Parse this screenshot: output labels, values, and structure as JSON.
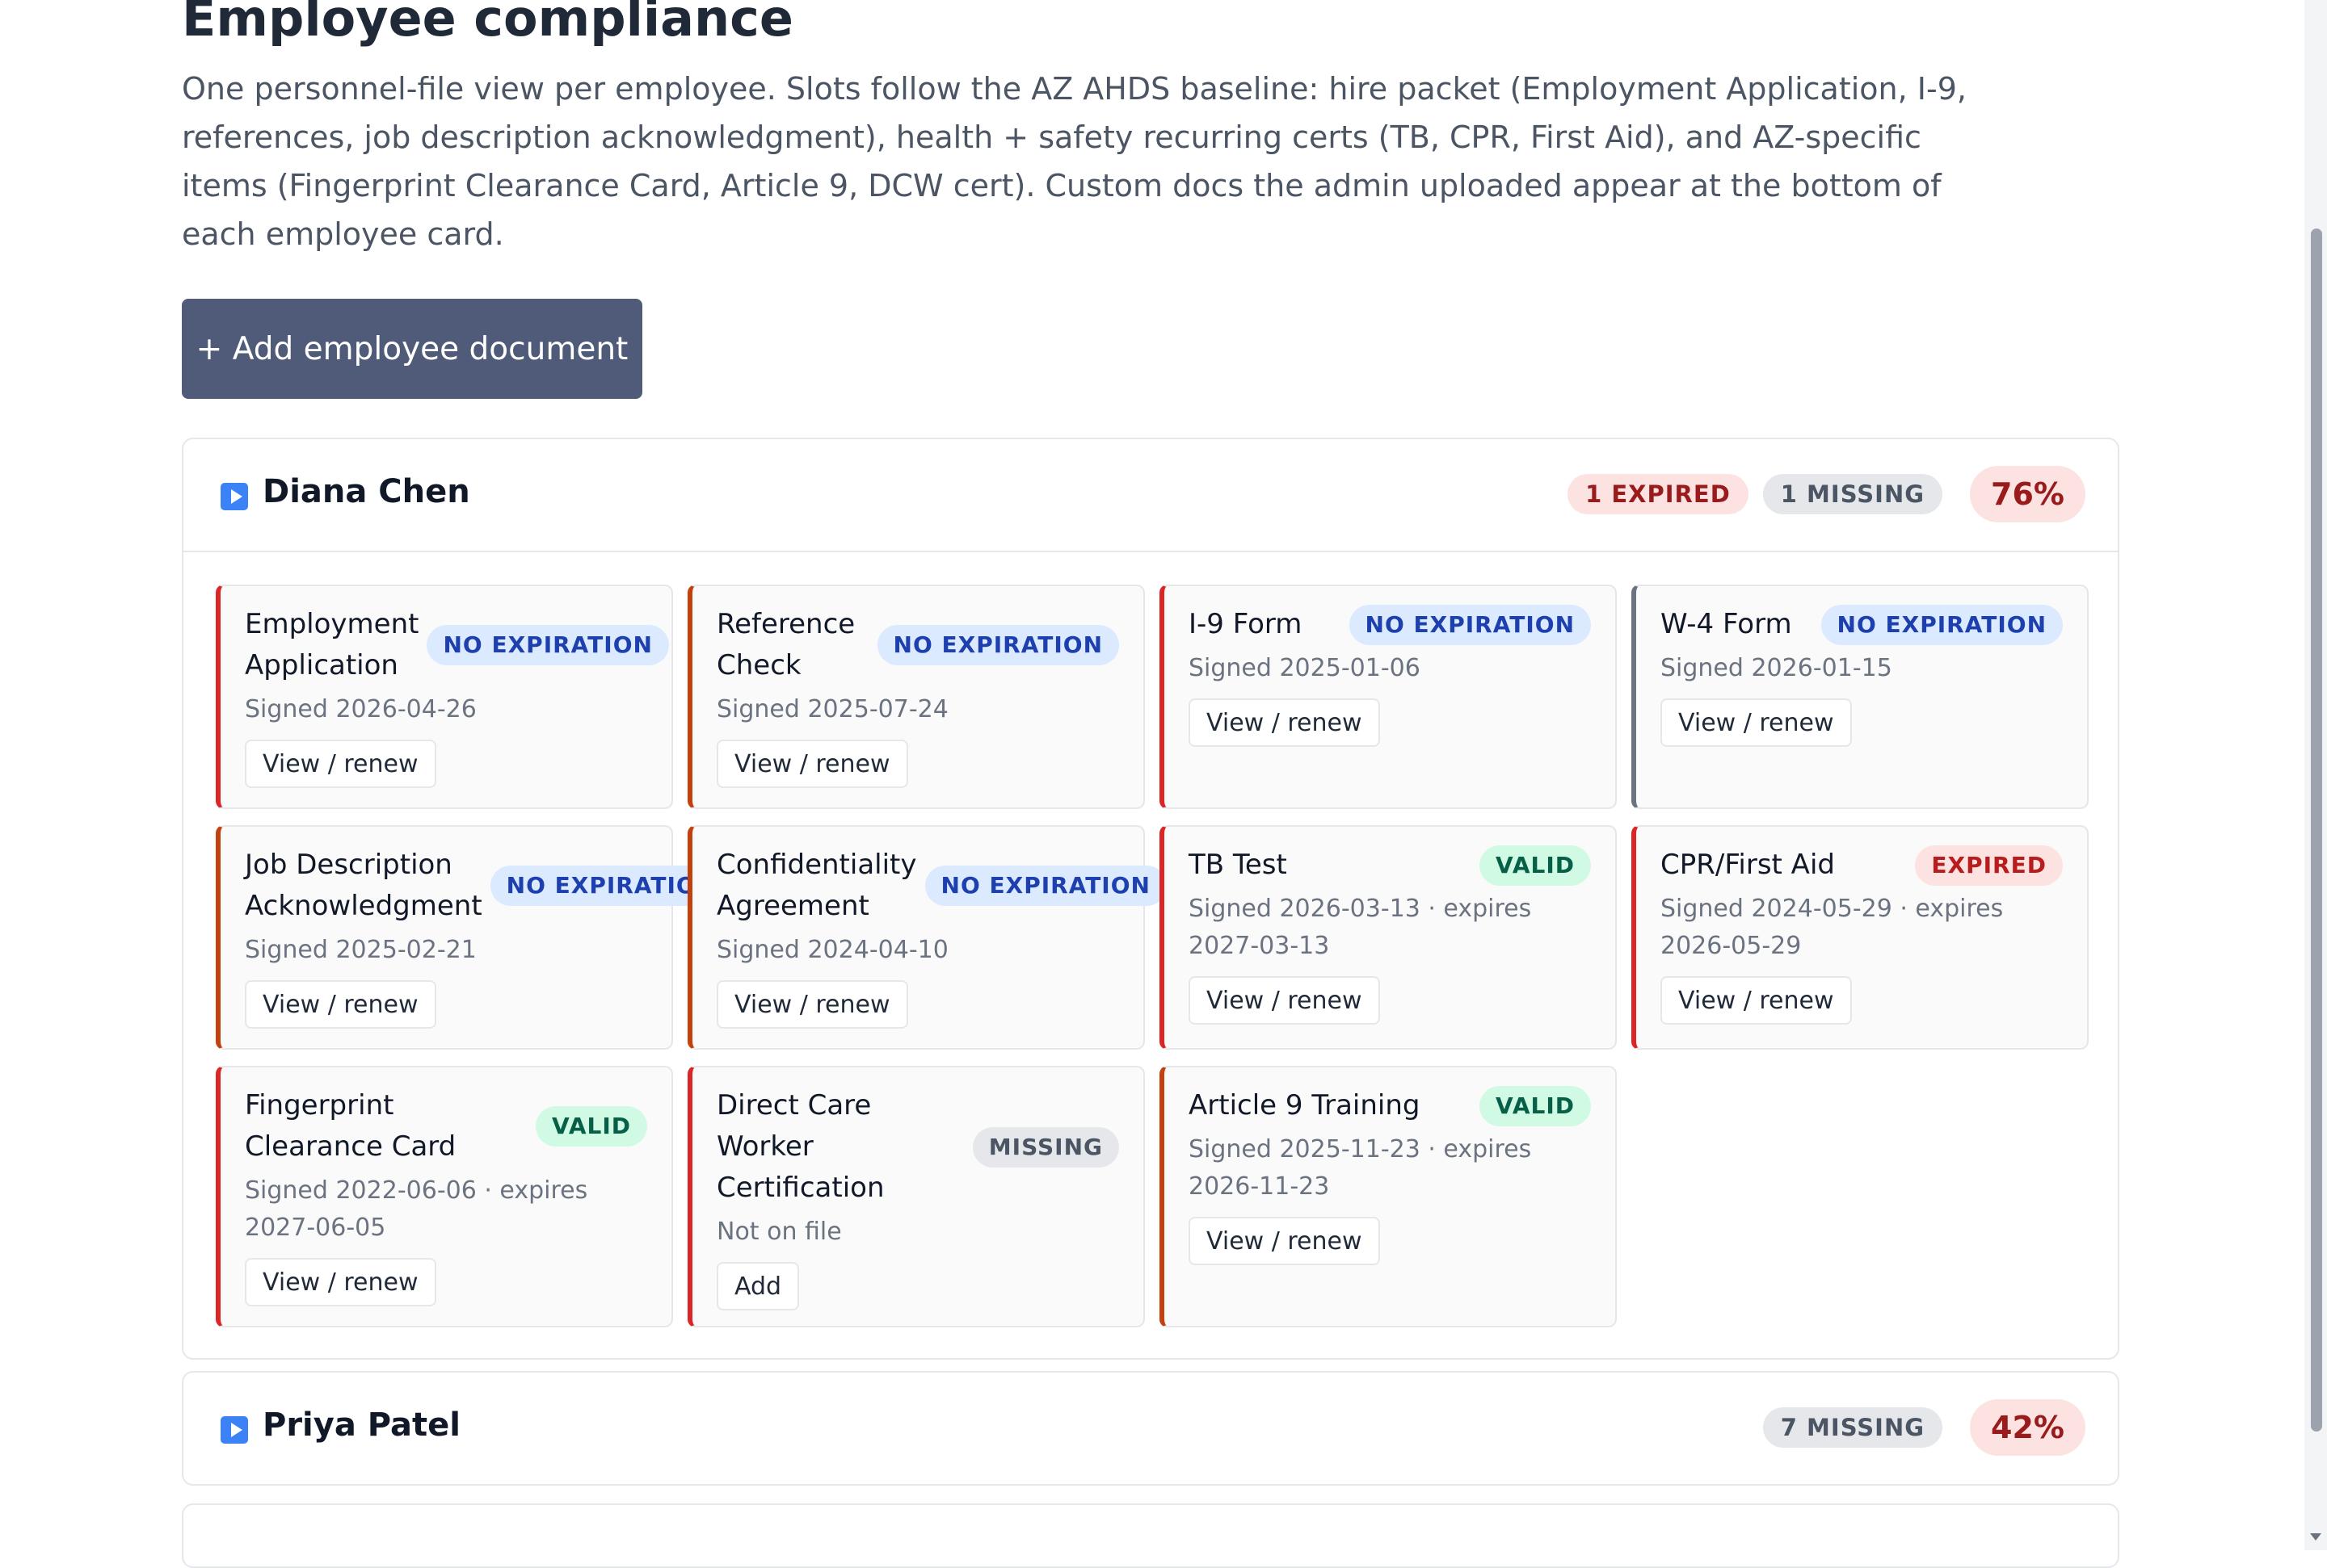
{
  "page": {
    "title": "Employee compliance",
    "description": "One personnel-file view per employee. Slots follow the AZ AHDS baseline: hire packet (Employment Application, I-9, references, job description acknowledgment), health + safety recurring certs (TB, CPR, First Aid), and AZ-specific items (Fingerprint Clearance Card, Article 9, DCW cert). Custom docs the admin uploaded appear at the bottom of each employee card.",
    "add_button_label": "+ Add employee document"
  },
  "employees": [
    {
      "name": "Diana Chen",
      "expired_label": "1 EXPIRED",
      "missing_label": "1 MISSING",
      "percent": "76%",
      "documents": [
        {
          "name": "Employment Application",
          "status": "NO EXPIRATION",
          "meta": "Signed 2026-04-26",
          "action": "View / renew"
        },
        {
          "name": "Reference Check",
          "status": "NO EXPIRATION",
          "meta": "Signed 2025-07-24",
          "action": "View / renew"
        },
        {
          "name": "I-9 Form",
          "status": "NO EXPIRATION",
          "meta": "Signed 2025-01-06",
          "action": "View / renew"
        },
        {
          "name": "W-4 Form",
          "status": "NO EXPIRATION",
          "meta": "Signed 2026-01-15",
          "action": "View / renew"
        },
        {
          "name": "Job Description Acknowledgment",
          "status": "NO EXPIRATION",
          "meta": "Signed 2025-02-21",
          "action": "View / renew"
        },
        {
          "name": "Confidentiality Agreement",
          "status": "NO EXPIRATION",
          "meta": "Signed 2024-04-10",
          "action": "View / renew"
        },
        {
          "name": "TB Test",
          "status": "VALID",
          "meta": "Signed 2026-03-13 · expires 2027-03-13",
          "action": "View / renew"
        },
        {
          "name": "CPR/First Aid",
          "status": "EXPIRED",
          "meta": "Signed 2024-05-29 · expires 2026-05-29",
          "action": "View / renew"
        },
        {
          "name": "Fingerprint Clearance Card",
          "status": "VALID",
          "meta": "Signed 2022-06-06 · expires 2027-06-05",
          "action": "View / renew"
        },
        {
          "name": "Direct Care Worker Certification",
          "status": "MISSING",
          "meta": "Not on file",
          "action": "Add"
        },
        {
          "name": "Article 9 Training",
          "status": "VALID",
          "meta": "Signed 2025-11-23 · expires 2026-11-23",
          "action": "View / renew"
        }
      ]
    },
    {
      "name": "Priya Patel",
      "missing_label": "7 MISSING",
      "percent": "42%"
    }
  ],
  "colors": {
    "primary_button": "#4f5b78",
    "no_expiration": "#1e40af",
    "valid": "#065f46",
    "expired": "#b91c1c",
    "missing": "#4b5563",
    "accent_red": "#dc2626",
    "accent_orange": "#c2410c",
    "accent_gray": "#6b7280"
  },
  "icons": {
    "toggle": "expand-toggle-icon"
  }
}
